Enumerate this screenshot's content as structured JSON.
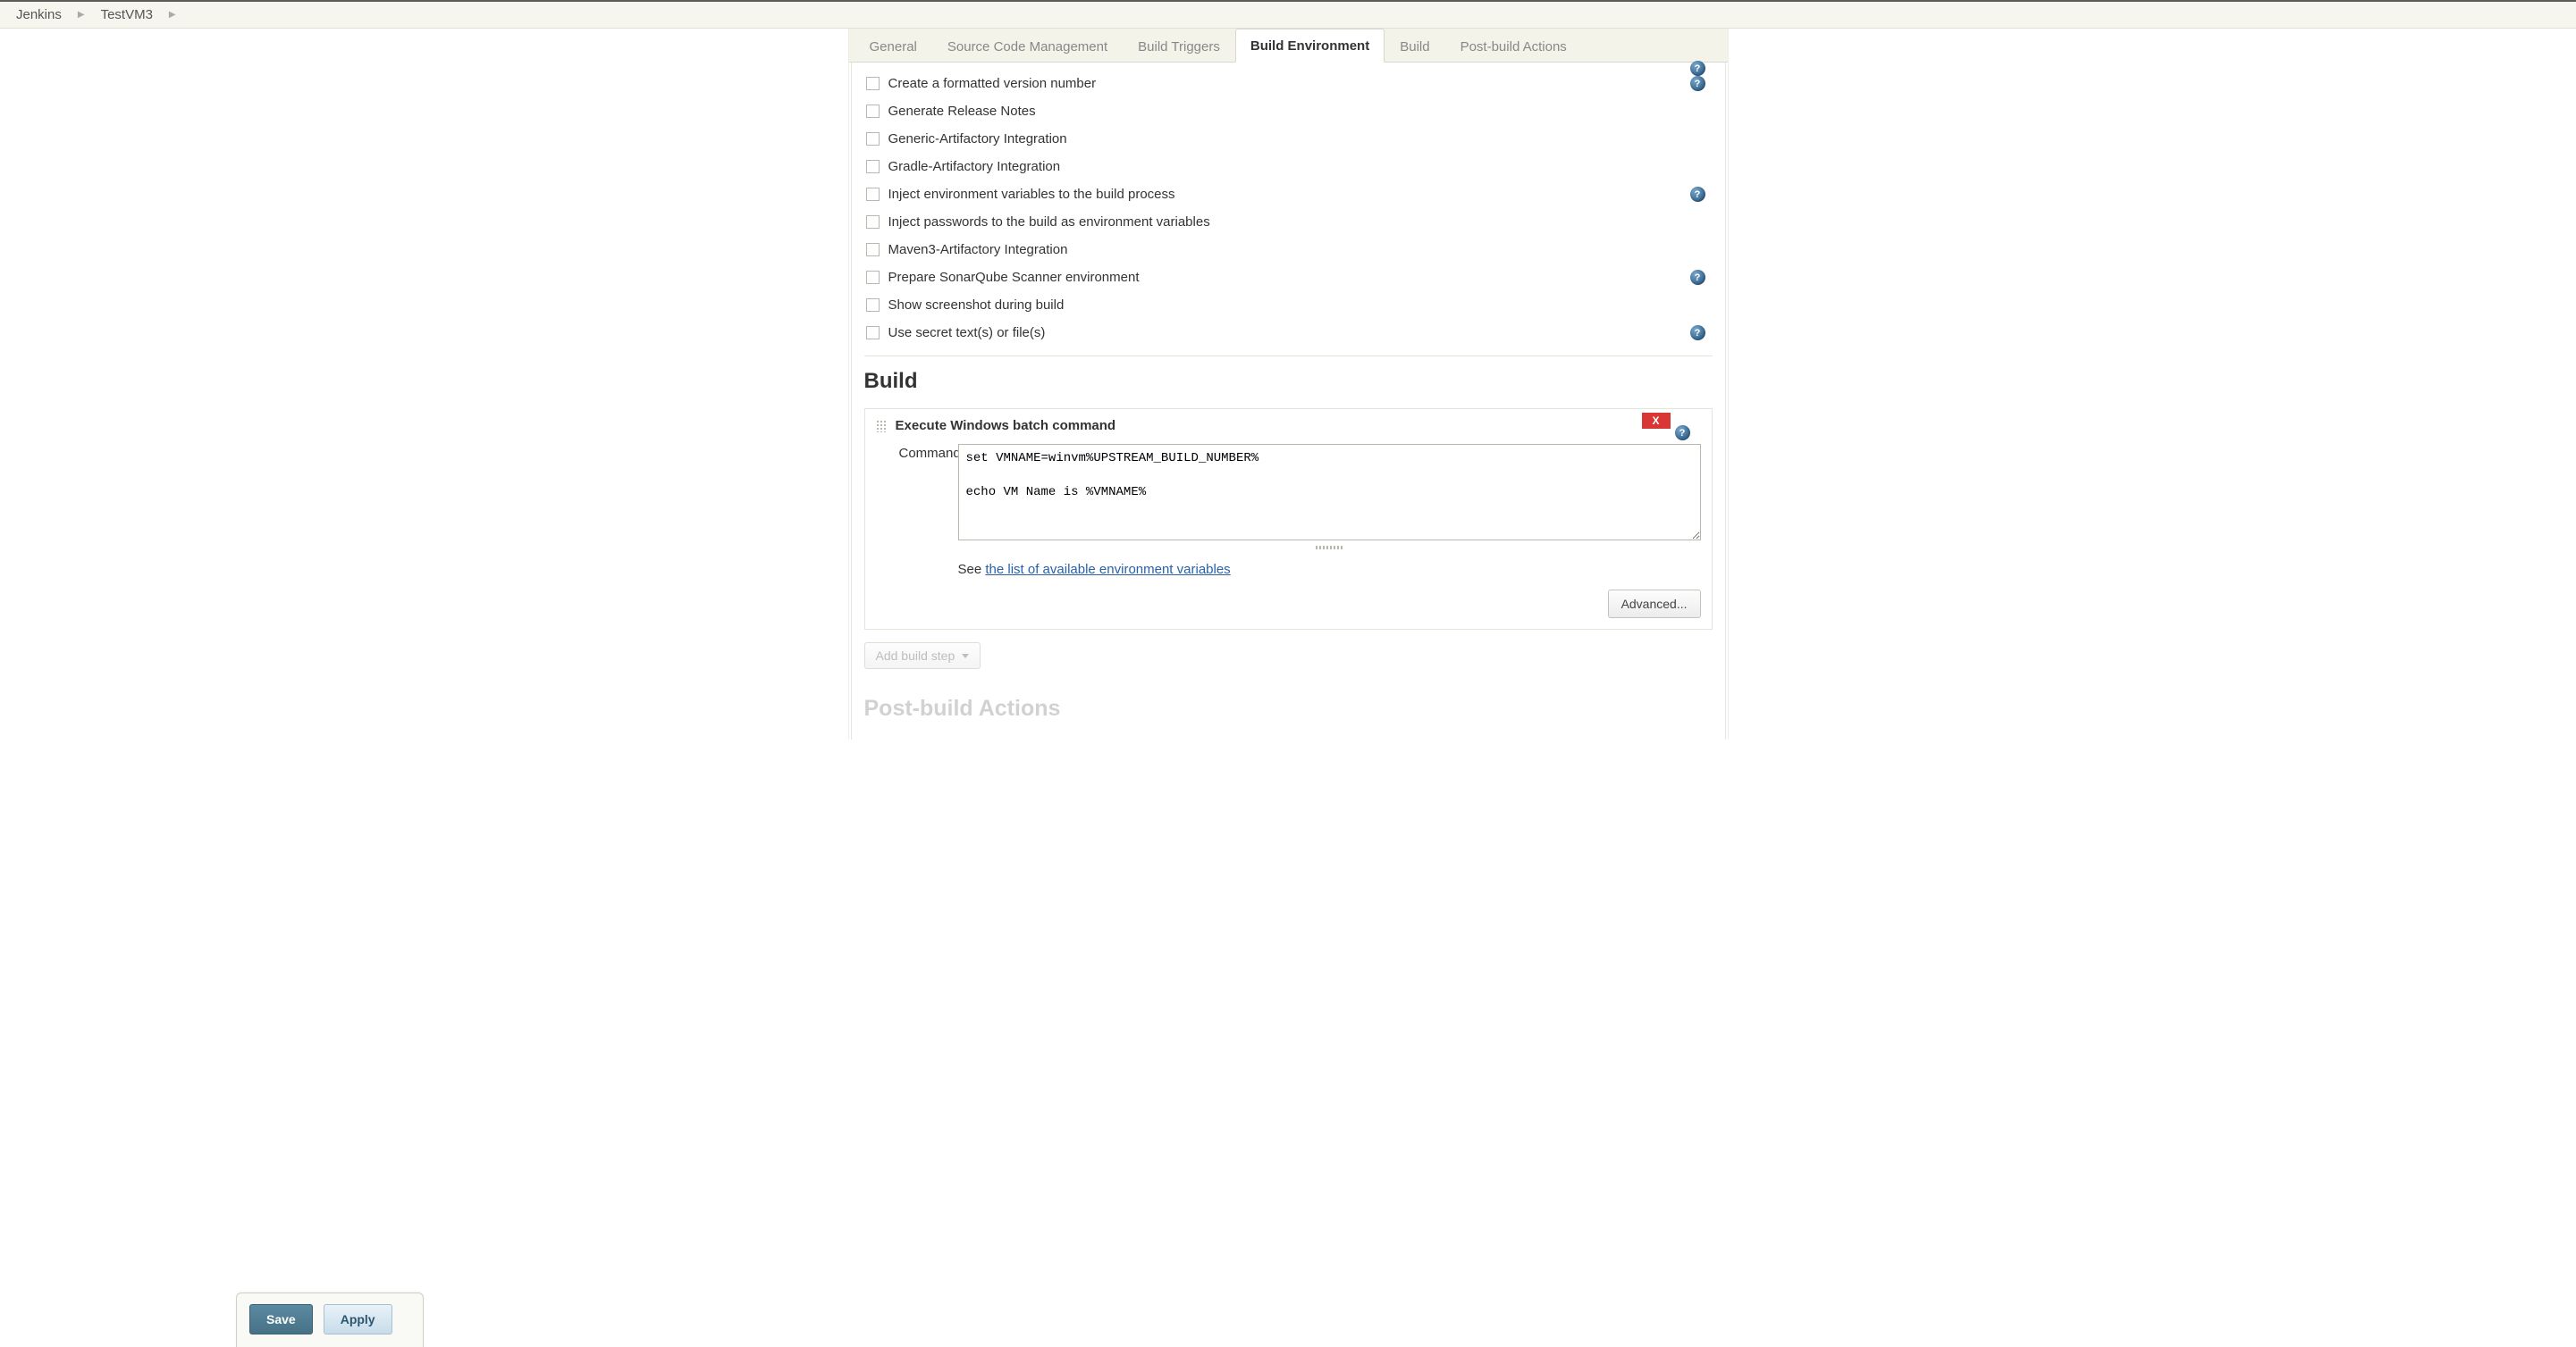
{
  "breadcrumb": {
    "items": [
      "Jenkins",
      "TestVM3"
    ]
  },
  "tabs": {
    "items": [
      {
        "label": "General",
        "active": false
      },
      {
        "label": "Source Code Management",
        "active": false
      },
      {
        "label": "Build Triggers",
        "active": false
      },
      {
        "label": "Build Environment",
        "active": true
      },
      {
        "label": "Build",
        "active": false
      },
      {
        "label": "Post-build Actions",
        "active": false
      }
    ]
  },
  "build_env": {
    "checkboxes": [
      {
        "label": "Create a formatted version number",
        "help": true
      },
      {
        "label": "Generate Release Notes",
        "help": false
      },
      {
        "label": "Generic-Artifactory Integration",
        "help": false
      },
      {
        "label": "Gradle-Artifactory Integration",
        "help": false
      },
      {
        "label": "Inject environment variables to the build process",
        "help": true
      },
      {
        "label": "Inject passwords to the build as environment variables",
        "help": false
      },
      {
        "label": "Maven3-Artifactory Integration",
        "help": false
      },
      {
        "label": "Prepare SonarQube Scanner environment",
        "help": true
      },
      {
        "label": "Show screenshot during build",
        "help": false
      },
      {
        "label": "Use secret text(s) or file(s)",
        "help": true
      }
    ]
  },
  "sections": {
    "build": "Build",
    "postbuild": "Post-build Actions"
  },
  "build_step": {
    "title": "Execute Windows batch command",
    "delete": "X",
    "command_label": "Command",
    "command_value": "set VMNAME=winvm%UPSTREAM_BUILD_NUMBER%\n\necho VM Name is %VMNAME%",
    "hint_prefix": "See ",
    "hint_link": "the list of available environment variables",
    "advanced": "Advanced..."
  },
  "add_step": "Add build step",
  "footer": {
    "save": "Save",
    "apply": "Apply"
  },
  "help_glyph": "?"
}
